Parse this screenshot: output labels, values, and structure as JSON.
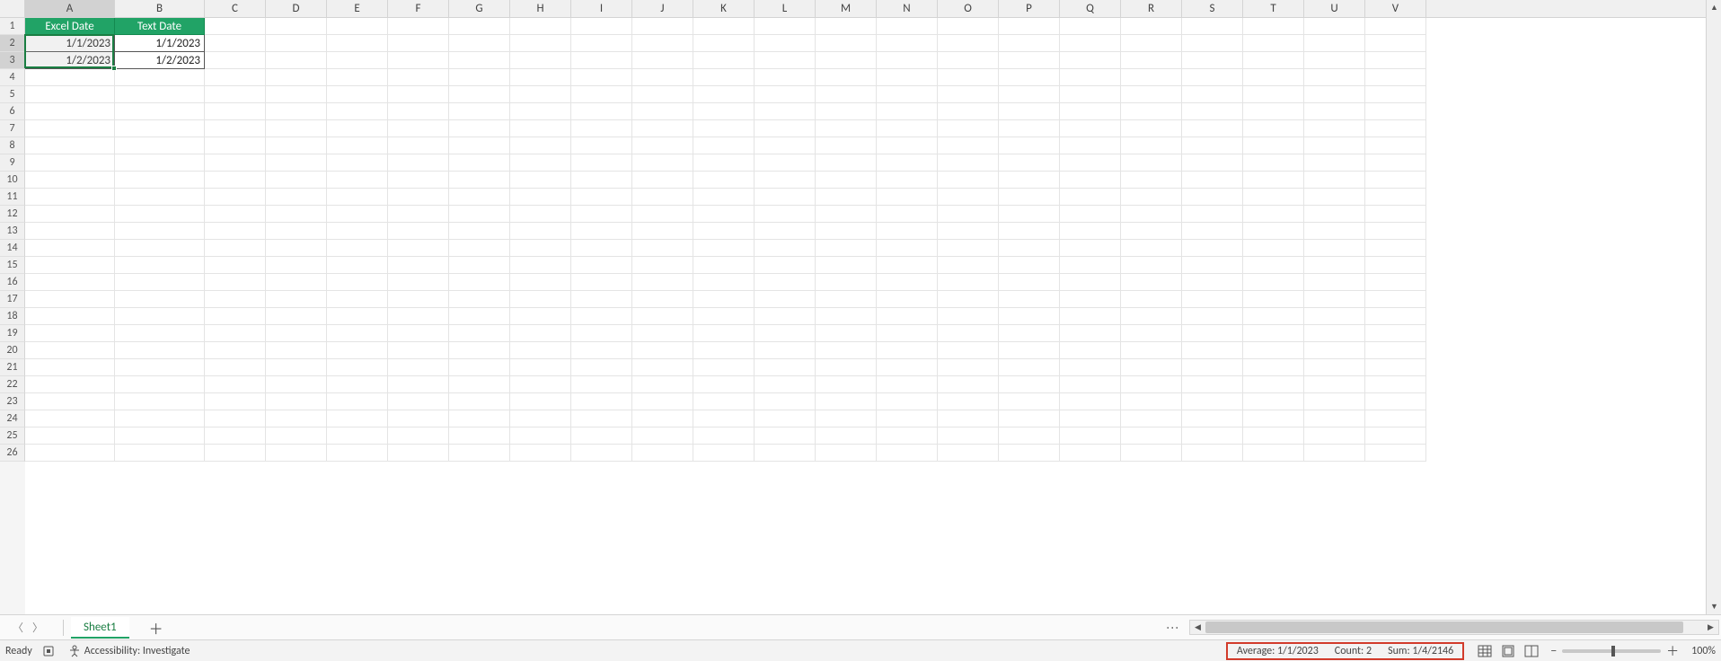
{
  "columns": [
    "A",
    "B",
    "C",
    "D",
    "E",
    "F",
    "G",
    "H",
    "I",
    "J",
    "K",
    "L",
    "M",
    "N",
    "O",
    "P",
    "Q",
    "R",
    "S",
    "T",
    "U",
    "V"
  ],
  "rowCount": 26,
  "selectedColumn": "A",
  "selectedRows": [
    2,
    3
  ],
  "headers": {
    "a": "Excel Date",
    "b": "Text Date"
  },
  "data": {
    "a2": "1/1/2023",
    "b2": "1/1/2023",
    "a3": "1/2/2023",
    "b3": "1/2/2023"
  },
  "sheet": {
    "active": "Sheet1"
  },
  "status": {
    "mode": "Ready",
    "accessibility": "Accessibility: Investigate",
    "average_label": "Average:",
    "average_value": "1/1/2023",
    "count_label": "Count:",
    "count_value": "2",
    "sum_label": "Sum:",
    "sum_value": "1/4/2146",
    "zoom": "100%"
  }
}
